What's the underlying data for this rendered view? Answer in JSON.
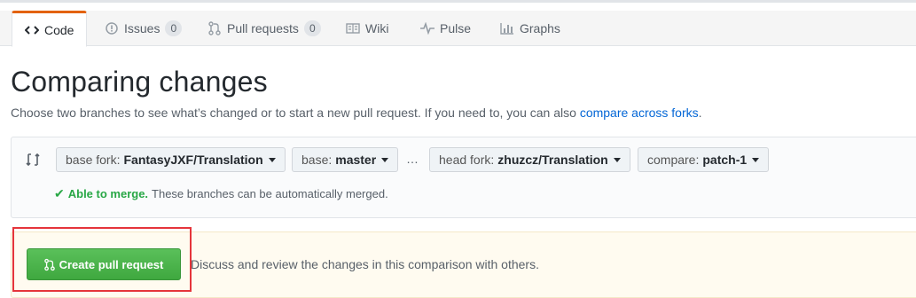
{
  "tabs": [
    {
      "label": "Code",
      "icon": "code-icon",
      "selected": true
    },
    {
      "label": "Issues",
      "icon": "issue-icon",
      "count": "0"
    },
    {
      "label": "Pull requests",
      "icon": "pull-request-icon",
      "count": "0"
    },
    {
      "label": "Wiki",
      "icon": "book-icon"
    },
    {
      "label": "Pulse",
      "icon": "pulse-icon"
    },
    {
      "label": "Graphs",
      "icon": "graph-icon"
    }
  ],
  "page": {
    "title": "Comparing changes",
    "subtitle": "Choose two branches to see what’s changed or to start a new pull request. If you need to, you can also",
    "subtitle_link": "compare across forks",
    "subtitle_end": "."
  },
  "range": {
    "base_fork_label": "base fork:",
    "base_fork_value": "FantasyJXF/Translation",
    "base_label": "base:",
    "base_value": "master",
    "separator": "…",
    "head_fork_label": "head fork:",
    "head_fork_value": "zhuzcz/Translation",
    "compare_label": "compare:",
    "compare_value": "patch-1",
    "merge_status": "Able to merge.",
    "merge_text": "These branches can be automatically merged."
  },
  "pr": {
    "button_label": "Create pull request",
    "description": "Discuss and review the changes in this comparison with others."
  },
  "colors": {
    "accent_tab": "#e36209",
    "link": "#0366d6",
    "success": "#28a745",
    "highlight": "#e5353b"
  }
}
